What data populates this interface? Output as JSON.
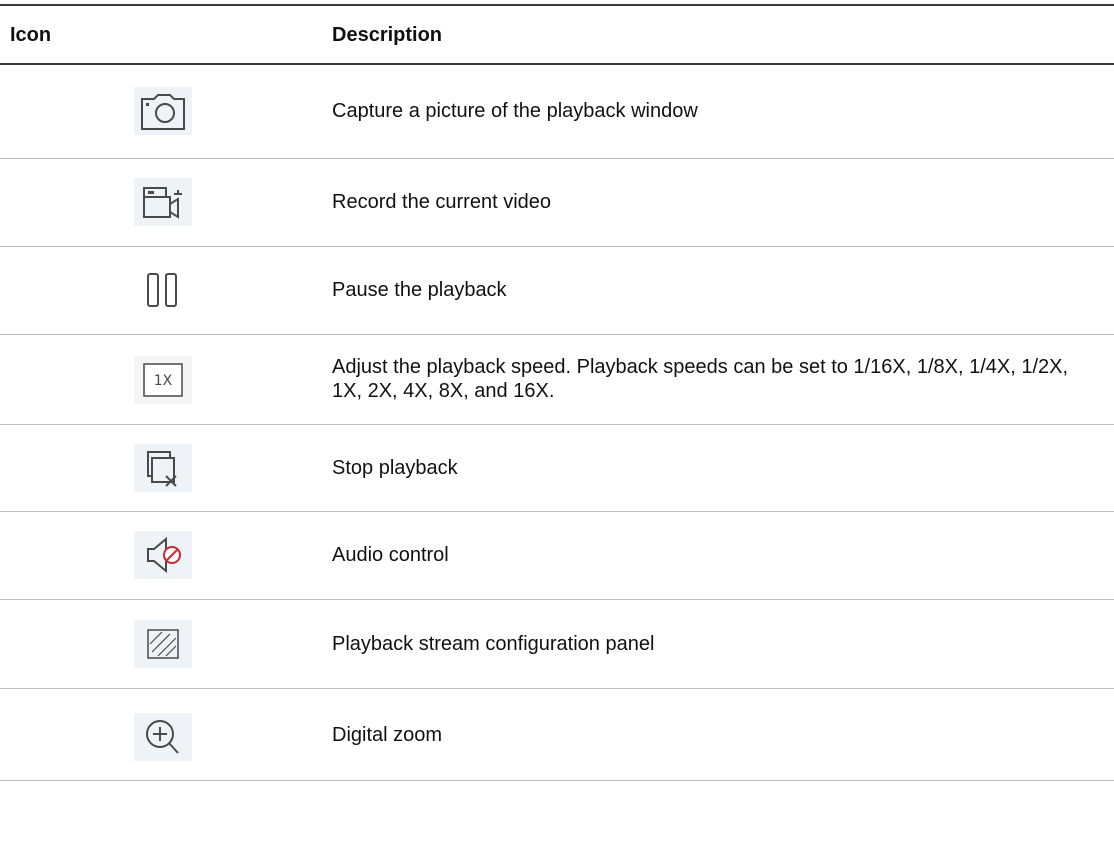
{
  "header": {
    "icon_col": "Icon",
    "description_col": "Description"
  },
  "rows": [
    {
      "icon": "camera-icon",
      "description": "Capture a picture of the playback window"
    },
    {
      "icon": "record-video-icon",
      "description": "Record the current video"
    },
    {
      "icon": "pause-icon",
      "description": "Pause the playback"
    },
    {
      "icon": "speed-1x-icon",
      "icon_text": "1X",
      "description": "Adjust the playback speed. Playback speeds can be set to 1/16X, 1/8X, 1/4X, 1/2X, 1X, 2X, 4X, 8X, and 16X."
    },
    {
      "icon": "stop-playback-icon",
      "description": "Stop playback"
    },
    {
      "icon": "audio-muted-icon",
      "description": "Audio control"
    },
    {
      "icon": "stream-config-icon",
      "description": "Playback stream configuration panel"
    },
    {
      "icon": "digital-zoom-icon",
      "description": "Digital zoom"
    }
  ],
  "colors": {
    "rule": "#3a3a3a",
    "divider": "#bdbdbd",
    "icon_stroke": "#4a4a4a",
    "mute_red": "#d0282e",
    "icon_bg": "#eef3f8"
  }
}
